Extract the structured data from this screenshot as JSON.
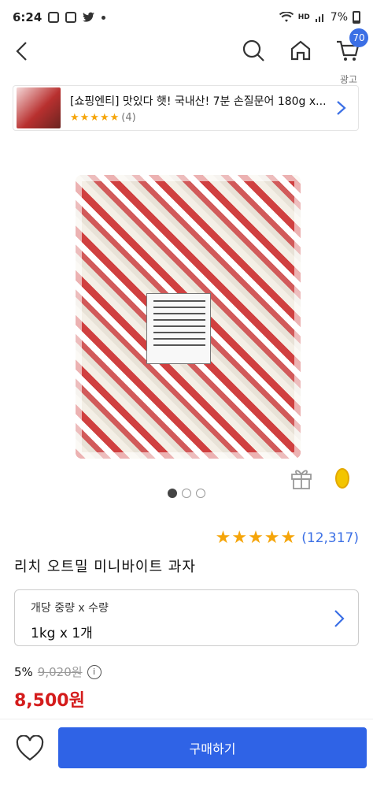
{
  "status_bar": {
    "time": "6:24",
    "signal_label": "HD",
    "battery": "7%"
  },
  "nav": {
    "cart_count": "70",
    "icons": [
      "chevron-left-icon",
      "search-icon",
      "home-icon",
      "cart-icon"
    ]
  },
  "ad": {
    "label": "광고",
    "title": "[쇼핑엔티] 맛있다 햇! 국내산! 7분 손질문어 180g x...",
    "stars": "★★★★★",
    "review_count": "(4)"
  },
  "gallery": {
    "total_images": 3,
    "active_index": 0
  },
  "product": {
    "stars": "★★★★★",
    "review_count": "(12,317)",
    "name": "리치 오트밀 미니바이트 과자"
  },
  "option": {
    "label": "개당 중량 x 수량",
    "value": "1kg x 1개"
  },
  "price": {
    "discount": "5%",
    "original": "9,020원",
    "final": "8,500원",
    "info_icon": "i"
  },
  "bottom": {
    "buy_label": "구매하기"
  },
  "colors": {
    "accent": "#2f63e6",
    "price_red": "#d41c1c",
    "star": "#f5a50a"
  }
}
